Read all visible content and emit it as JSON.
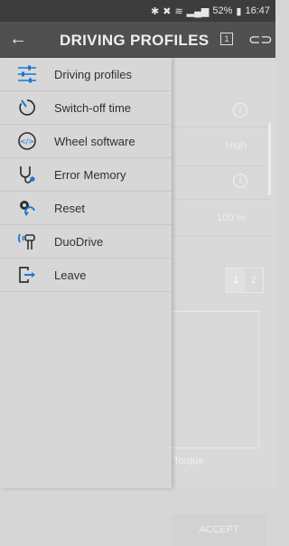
{
  "status": {
    "icons": [
      "bluetooth-icon",
      "mute-icon",
      "wifi-icon",
      "signal-icon"
    ],
    "battery": "52%",
    "time": "16:47"
  },
  "appbar": {
    "title": "DRIVING PROFILES",
    "profile_badge": "1"
  },
  "menu": {
    "items": [
      {
        "label": "Driving profiles",
        "icon": "sliders-icon"
      },
      {
        "label": "Switch-off time",
        "icon": "timer-icon"
      },
      {
        "label": "Wheel software",
        "icon": "code-icon"
      },
      {
        "label": "Error Memory",
        "icon": "stethoscope-icon"
      },
      {
        "label": "Reset",
        "icon": "reset-gear-icon"
      },
      {
        "label": "DuoDrive",
        "icon": "duodrive-icon"
      },
      {
        "label": "Leave",
        "icon": "exit-icon"
      }
    ]
  },
  "content": {
    "value_high": "High",
    "value_percent": "100 %",
    "segments": [
      "1",
      "2"
    ],
    "torque_label": "Torque",
    "accept_label": "ACCEPT"
  },
  "colors": {
    "accent_blue": "#1976d2",
    "appbar_bg": "#505050",
    "drawer_bg": "#d7d7d7"
  }
}
